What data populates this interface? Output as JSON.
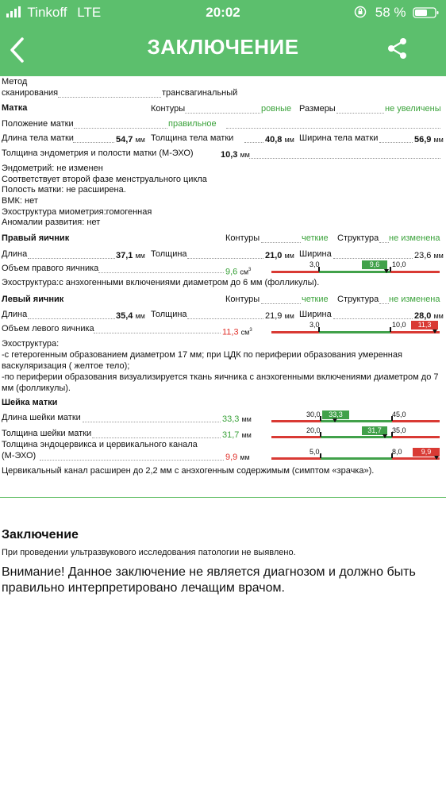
{
  "status_bar": {
    "carrier": "Tinkoff",
    "network": "LTE",
    "time": "20:02",
    "battery": "58 %"
  },
  "header": {
    "title": "ЗАКЛЮЧЕНИЕ"
  },
  "method": {
    "label1": "Метод",
    "label2": "сканирования",
    "value": "трансвагинальный"
  },
  "uterus": {
    "title": "Матка",
    "contours_label": "Контуры",
    "contours_value": "ровные",
    "size_label": "Размеры",
    "size_value": "не увеличены",
    "position_label": "Положение матки",
    "position_value": "правильное",
    "length_label": "Длина тела матки",
    "length_value": "54,7",
    "thickness_label": "Толщина тела матки",
    "thickness_value": "40,8",
    "width_label": "Ширина тела матки",
    "width_value": "56,9",
    "endometrium_label": "Толщина эндометрия и полости матки (М-ЭХО)",
    "endometrium_value": "10,3",
    "unit": "мм",
    "notes": [
      "Эндометрий: не изменен",
      "Соответствует второй  фазе  менструального цикла",
      "Полость матки: не расширена.",
      "ВМК: нет",
      "Эхоструктура миометрия:гомогенная",
      "Аномалии развития: нет"
    ]
  },
  "right_ovary": {
    "title": "Правый яичник",
    "contours_label": "Контуры",
    "contours_value": "четкие",
    "structure_label": "Структура",
    "structure_value": "не изменена",
    "length_label": "Длина",
    "length_value": "37,1",
    "thickness_label": "Толщина",
    "thickness_value": "21,0",
    "width_label": "Ширина",
    "width_value": "23,6",
    "volume_label": "Объем правого яичника",
    "volume_value": "9,6",
    "volume_unit": "см",
    "scale_min": "3,0",
    "scale_max": "10,0",
    "scale_value": "9,6",
    "echo": "Эхоструктура:с анэхогенными включениями диаметром до 6 мм (фолликулы)."
  },
  "left_ovary": {
    "title": "Левый яичник",
    "contours_label": "Контуры",
    "contours_value": "четкие",
    "structure_label": "Структура",
    "structure_value": "не изменена",
    "length_label": "Длина",
    "length_value": "35,4",
    "thickness_label": "Толщина",
    "thickness_value": "21,9",
    "width_label": "Ширина",
    "width_value": "28,0",
    "volume_label": "Объем левого яичника",
    "volume_value": "11,3",
    "volume_unit": "см",
    "scale_min": "3,0",
    "scale_max": "10,0",
    "scale_value": "11,3",
    "echo_lines": [
      "Эхоструктура:",
      "-с гетерогенным образованием диаметром  17 мм; при ЦДК по периферии образования умеренная",
      "васкуляризация ( желтое тело);",
      "-по периферии образования визуализируется ткань яичника с анэхогенными включениями диаметром до 7",
      "мм (фолликулы)."
    ]
  },
  "cervix": {
    "title": "Шейка матки",
    "length_label": "Длина шейки матки",
    "length_value": "33,3",
    "length_min": "30,0",
    "length_max": "45,0",
    "thickness_label": "Толщина шейки матки",
    "thickness_value": "31,7",
    "thickness_min": "20,0",
    "thickness_max": "35,0",
    "endo_label1": "Толщина эндоцервикса и цервикального канала",
    "endo_label2": "(М-ЭХО)",
    "endo_value": "9,9",
    "endo_min": "5,0",
    "endo_max": "8,0",
    "unit": "мм",
    "note": "Цервикальный канал расширен до 2,2  мм с анэхогенным содержимым (симптом «зрачка»)."
  },
  "conclusion": {
    "title": "Заключение",
    "text": "При проведении ультразвукового исследования патологии не выявлено.",
    "warning_line1": "Внимание! Данное заключение не является диагнозом и должно быть",
    "warning_line2": "правильно интерпретировано лечащим врачом."
  },
  "colors": {
    "header": "#5cbf6d",
    "green": "#3aa23a",
    "red": "#e0332c",
    "bar_green": "#41a14a",
    "bar_red": "#d93a34"
  },
  "icons": {
    "back": "chevron-left-icon",
    "share": "share-icon",
    "signal": "signal-icon",
    "lock": "orientation-lock-icon",
    "battery": "battery-icon"
  }
}
